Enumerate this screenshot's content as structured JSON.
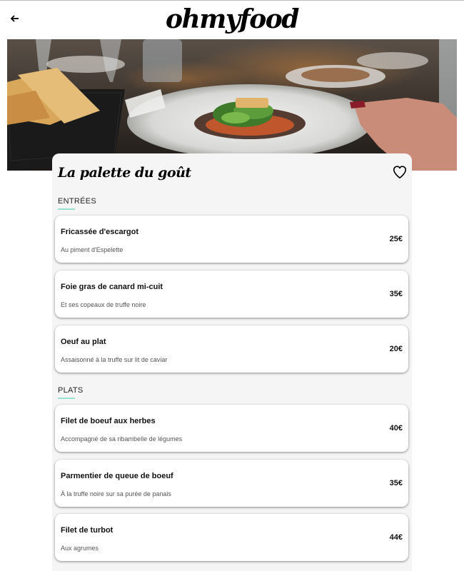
{
  "header": {
    "brand": "ohmyfood",
    "back_icon": "arrow-left-icon"
  },
  "hero": {
    "image": "restaurant-dish-photo"
  },
  "restaurant": {
    "name": "La palette du goût",
    "favorite_icon": "heart-outline-icon"
  },
  "sections": [
    {
      "label": "ENTRÉES",
      "dishes": [
        {
          "name": "Fricassée d'escargot",
          "description": "Au piment d'Espelette",
          "price": "25€"
        },
        {
          "name": "Foie gras de canard mi-cuit",
          "description": "Et ses copeaux de truffe noire",
          "price": "35€"
        },
        {
          "name": "Oeuf au plat",
          "description": "Assaisonné à la truffe sur lit de caviar",
          "price": "20€"
        }
      ]
    },
    {
      "label": "PLATS",
      "dishes": [
        {
          "name": "Filet de boeuf aux herbes",
          "description": "Accompagné de sa ribambelle de légumes",
          "price": "40€"
        },
        {
          "name": "Parmentier de queue de boeuf",
          "description": "À la truffe noire sur sa purée de panais",
          "price": "35€"
        },
        {
          "name": "Filet de turbot",
          "description": "Aux agrumes",
          "price": "44€"
        }
      ]
    }
  ],
  "colors": {
    "accent_underline": "#99e2d0",
    "menu_background": "#f5f5f5"
  }
}
